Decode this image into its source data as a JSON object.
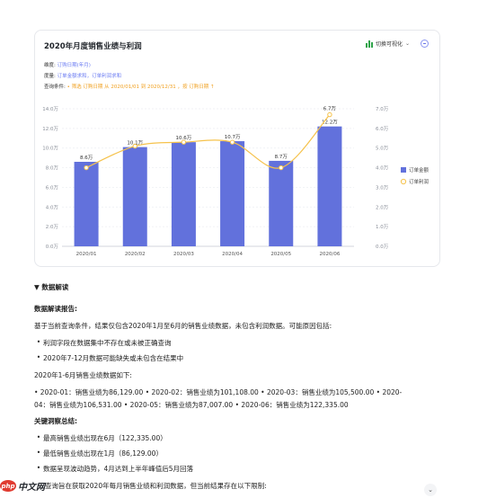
{
  "card": {
    "title": "2020年月度销售业绩与利润",
    "switch_label": "切换可视化",
    "dimension_label": "维度:",
    "dimension_value": "订购日期(年月)",
    "measure_label": "度量:",
    "measure_value": "订单金额求和，订单利润求和",
    "condition_label": "查询条件:",
    "condition_value": "• 筛选 订购日期 从 2020/01/01 到 2020/12/31 ，按 订购日期 ↑"
  },
  "colors": {
    "bar": "#6271dc",
    "line": "#f5c24c",
    "accent": "#6b7cf2"
  },
  "chart_data": {
    "type": "bar",
    "categories": [
      "2020/01",
      "2020/02",
      "2020/03",
      "2020/04",
      "2020/05",
      "2020/06"
    ],
    "series": [
      {
        "name": "订单金额",
        "type": "bar",
        "axis": "left",
        "values": [
          8.6,
          10.1,
          10.6,
          10.7,
          8.7,
          12.2
        ],
        "labels": [
          "8.6万",
          "10.1万",
          "10.6万",
          "10.7万",
          "8.7万",
          "12.2万"
        ]
      },
      {
        "name": "订单利润",
        "type": "line",
        "axis": "right",
        "values": [
          4.0,
          5.1,
          5.3,
          5.3,
          4.0,
          6.7
        ],
        "labels": [
          "",
          "",
          "",
          "",
          "",
          "6.7万"
        ]
      }
    ],
    "y_left": {
      "min": 0,
      "max": 14,
      "ticks": [
        "0.0万",
        "2.0万",
        "4.0万",
        "6.0万",
        "8.0万",
        "10.0万",
        "12.0万",
        "14.0万"
      ]
    },
    "y_right": {
      "min": 0,
      "max": 7,
      "ticks": [
        "0.0万",
        "1.0万",
        "2.0万",
        "3.0万",
        "4.0万",
        "5.0万",
        "6.0万",
        "7.0万"
      ]
    },
    "grid": true,
    "legend": "right"
  },
  "analysis": {
    "toggle_label": "▼ 数据解读",
    "report_heading": "数据解读报告:",
    "intro": "基于当前查询条件，结果仅包含2020年1月至6月的销售业绩数据，未包含利润数据。可能原因包括:",
    "reasons": [
      "利润字段在数据集中不存在或未被正确查询",
      "2020年7-12月数据可能缺失或未包含在结果中"
    ],
    "summary_title": "2020年1-6月销售业绩数据如下:",
    "summary_line1": "• 2020-01：销售业绩为86,129.00 • 2020-02：销售业绩为101,108.00 • 2020-03：销售业绩为105,500.00 • 2020-",
    "summary_line2": "04：销售业绩为106,531.00 • 2020-05：销售业绩为87,007.00 • 2020-06：销售业绩为122,335.00",
    "insights_heading": "关键洞察总结:",
    "insights": [
      "最高销售业绩出现在6月（122,335.00）",
      "最低销售业绩出现在1月（86,129.00）",
      "数据呈现波动趋势，4月达到上半年峰值后5月回落"
    ],
    "last_line": "查询旨在获取2020年每月销售业绩和利润数据，但当前结果存在以下限制:"
  },
  "watermark": {
    "php": "php",
    "cn": "中文网"
  },
  "scroll_icon": "chevron-down-icon"
}
